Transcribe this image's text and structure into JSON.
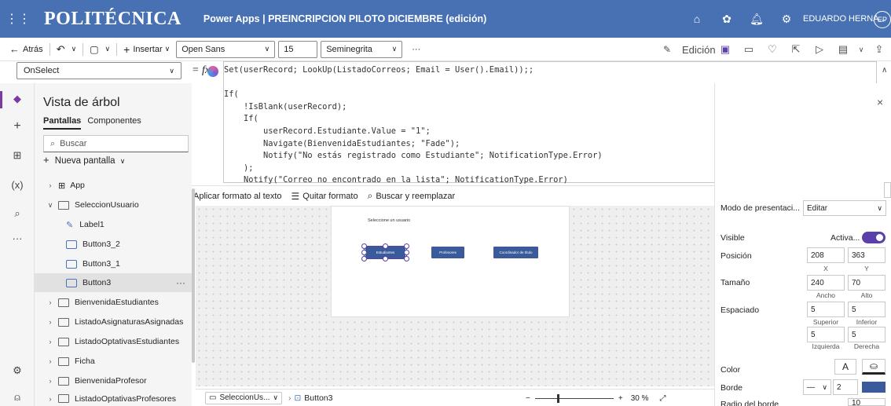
{
  "topbar": {
    "brand": "POLITÉCNICA",
    "app_title": "Power Apps | PREINCRIPCION PILOTO DICIEMBRE (edición)",
    "user": "EDUARDO HERNA...",
    "avatar": "EP"
  },
  "cmdbar": {
    "back": "Atrás",
    "insert": "Insertar",
    "font": "Open Sans",
    "font_size": "15",
    "font_weight": "Seminegrita",
    "more": "···",
    "edit": "Edición"
  },
  "formula": {
    "property": "OnSelect",
    "eq": "= fx",
    "lines": [
      "Set(userRecord; LookUp(ListadoCorreos; Email = User().Email));;",
      "",
      "If(",
      "    !IsBlank(userRecord);",
      "    If(",
      "        userRecord.Estudiante.Value = \"1\";",
      "        Navigate(BienvenidaEstudiantes; \"Fade\");",
      "        Notify(\"No estás registrado como Estudiante\"; NotificationType.Error)",
      "    );",
      "    Notify(\"Correo no encontrado en la lista\"; NotificationType.Error)",
      ")"
    ],
    "format_text": "Aplicar formato al texto",
    "remove_format": "Quitar formato",
    "find_replace": "Buscar y reemplazar"
  },
  "tree": {
    "title": "Vista de árbol",
    "tab_screens": "Pantallas",
    "tab_components": "Componentes",
    "search_placeholder": "Buscar",
    "new_screen": "Nueva pantalla",
    "items": [
      {
        "label": "App"
      },
      {
        "label": "SeleccionUsuario"
      },
      {
        "label": "Label1"
      },
      {
        "label": "Button3_2"
      },
      {
        "label": "Button3_1"
      },
      {
        "label": "Button3"
      },
      {
        "label": "BienvenidaEstudiantes"
      },
      {
        "label": "ListadoAsignaturasAsignadas"
      },
      {
        "label": "ListadoOptativasEstudiantes"
      },
      {
        "label": "Ficha"
      },
      {
        "label": "BienvenidaProfesor"
      },
      {
        "label": "ListadoOptativasProfesores"
      }
    ]
  },
  "canvas": {
    "label": "Seleccione un usuario",
    "buttons": [
      "Estudiantes",
      "Profesores",
      "Coordinador de título"
    ]
  },
  "status": {
    "screen": "SeleccionUs...",
    "control": "Button3",
    "zoom": "30 %"
  },
  "props": {
    "display_mode_label": "Modo de presentaci...",
    "display_mode_value": "Editar",
    "visible_label": "Visible",
    "visible_value": "Activa...",
    "position_label": "Posición",
    "x": "208",
    "y": "363",
    "x_label": "X",
    "y_label": "Y",
    "size_label": "Tamaño",
    "width": "240",
    "height": "70",
    "width_label": "Ancho",
    "height_label": "Alto",
    "padding_label": "Espaciado",
    "pad_top": "5",
    "pad_bottom": "5",
    "pad_left": "5",
    "pad_right": "5",
    "top_label": "Superior",
    "bottom_label": "Inferior",
    "left_label": "Izquierda",
    "right_label": "Derecha",
    "color_label": "Color",
    "color_letter": "A",
    "border_label": "Borde",
    "border_width": "2",
    "radius_label": "Radio del borde",
    "radius_value": "10",
    "accent_color": "#5a40a8",
    "button_color": "#3b5a9c"
  }
}
